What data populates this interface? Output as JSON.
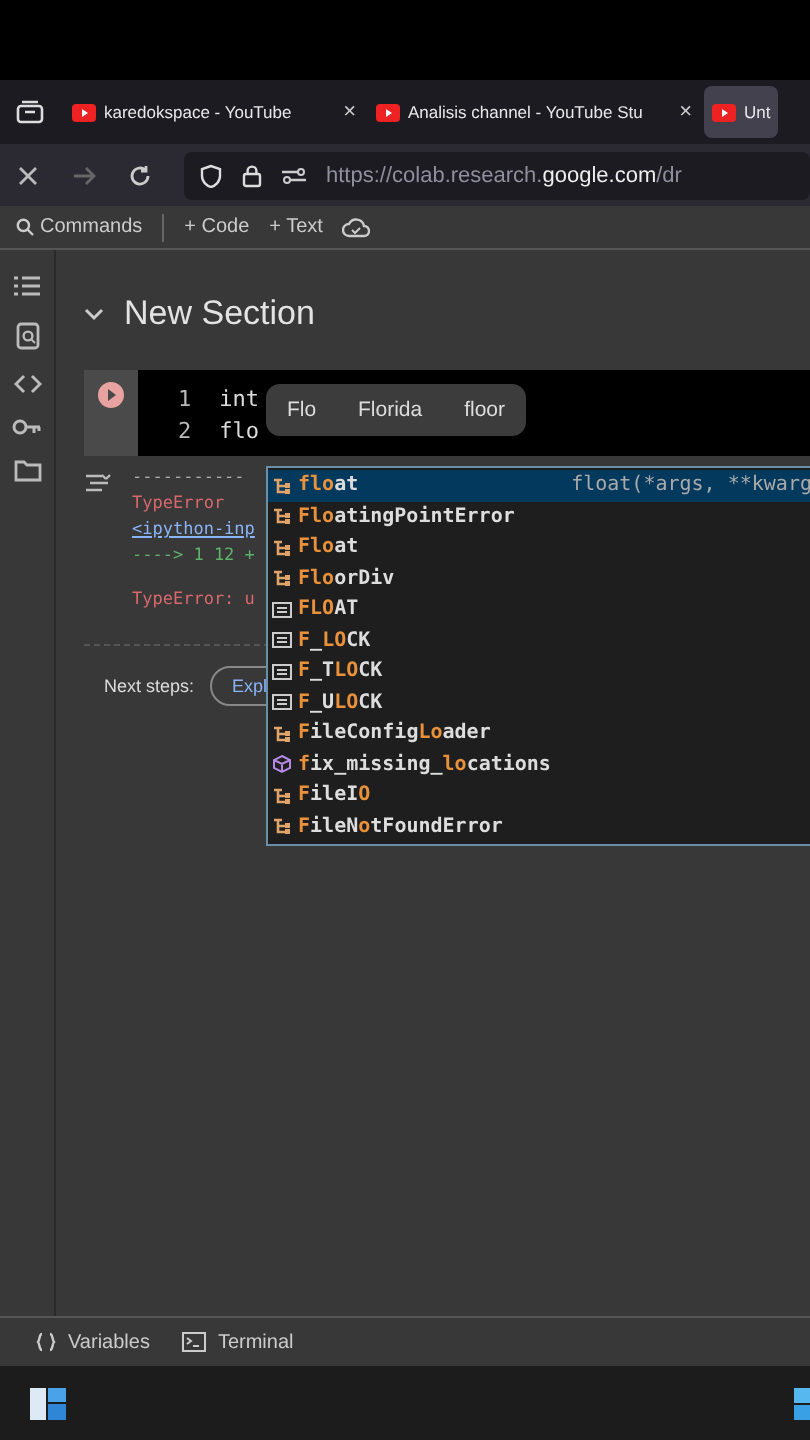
{
  "browser_tabs": [
    {
      "title": "karedokspace - YouTube",
      "close": "×",
      "selected": false
    },
    {
      "title": "Analisis channel - YouTube Stu",
      "close": "×",
      "selected": false
    },
    {
      "title": "Unt",
      "selected": true
    }
  ],
  "address": {
    "prefix": "https://colab.research.",
    "domain": "google.com",
    "rest": "/dr"
  },
  "toolbar": [
    {
      "label": "Commands",
      "kind": "search"
    },
    {
      "label": "+ Code",
      "kind": "plain"
    },
    {
      "label": "+ Text",
      "kind": "plain"
    }
  ],
  "section": {
    "title": "New Section",
    "expanded": true
  },
  "code_lines": [
    {
      "number": "1",
      "text": "int"
    },
    {
      "number": "2",
      "text": "flo"
    }
  ],
  "output": [
    {
      "text": "-----------",
      "kind": "rule"
    },
    {
      "text": "TypeError",
      "kind": "error"
    },
    {
      "text": "<ipython-inp",
      "kind": "link"
    },
    {
      "text": "----> 1 12 +",
      "kind": "arrow"
    },
    {
      "text": "TypeError: u",
      "kind": "error"
    }
  ],
  "next_steps": {
    "label": "Next steps:",
    "button": "Expl"
  },
  "suggestions": [
    "Flo",
    "Florida",
    "floor"
  ],
  "completions": [
    {
      "kind": "class",
      "selected": true,
      "parts": [
        {
          "t": "flo",
          "m": true
        },
        {
          "t": "at",
          "m": false
        }
      ],
      "detail": "float(*args, **kwarg"
    },
    {
      "kind": "class",
      "selected": false,
      "parts": [
        {
          "t": "Flo",
          "m": true
        },
        {
          "t": "atingPointError",
          "m": false
        }
      ]
    },
    {
      "kind": "class",
      "selected": false,
      "parts": [
        {
          "t": "Flo",
          "m": true
        },
        {
          "t": "at",
          "m": false
        }
      ]
    },
    {
      "kind": "class",
      "selected": false,
      "parts": [
        {
          "t": "Flo",
          "m": true
        },
        {
          "t": "orDiv",
          "m": false
        }
      ]
    },
    {
      "kind": "constant",
      "selected": false,
      "parts": [
        {
          "t": "FLO",
          "m": true
        },
        {
          "t": "AT",
          "m": false
        }
      ]
    },
    {
      "kind": "constant",
      "selected": false,
      "parts": [
        {
          "t": "F",
          "m": true
        },
        {
          "t": "_",
          "m": false
        },
        {
          "t": "LO",
          "m": true
        },
        {
          "t": "CK",
          "m": false
        }
      ]
    },
    {
      "kind": "constant",
      "selected": false,
      "parts": [
        {
          "t": "F",
          "m": true
        },
        {
          "t": "_T",
          "m": false
        },
        {
          "t": "LO",
          "m": true
        },
        {
          "t": "CK",
          "m": false
        }
      ]
    },
    {
      "kind": "constant",
      "selected": false,
      "parts": [
        {
          "t": "F",
          "m": true
        },
        {
          "t": "_U",
          "m": false
        },
        {
          "t": "LO",
          "m": true
        },
        {
          "t": "CK",
          "m": false
        }
      ]
    },
    {
      "kind": "class",
      "selected": false,
      "parts": [
        {
          "t": "F",
          "m": true
        },
        {
          "t": "ileConfig",
          "m": false
        },
        {
          "t": "Lo",
          "m": true
        },
        {
          "t": "ader",
          "m": false
        }
      ]
    },
    {
      "kind": "function",
      "selected": false,
      "parts": [
        {
          "t": "f",
          "m": true
        },
        {
          "t": "ix_missing_",
          "m": false
        },
        {
          "t": "lo",
          "m": true
        },
        {
          "t": "cations",
          "m": false
        }
      ]
    },
    {
      "kind": "class",
      "selected": false,
      "parts": [
        {
          "t": "F",
          "m": true
        },
        {
          "t": "ileI",
          "m": false
        },
        {
          "t": "O",
          "m": true
        }
      ]
    },
    {
      "kind": "class",
      "selected": false,
      "parts": [
        {
          "t": "F",
          "m": true
        },
        {
          "t": "ileN",
          "m": false
        },
        {
          "t": "o",
          "m": true
        },
        {
          "t": "tFoundError",
          "m": false
        }
      ]
    }
  ],
  "bottom_bar": [
    {
      "label": "Variables",
      "kind": "braces"
    },
    {
      "label": "Terminal",
      "kind": "terminal"
    }
  ]
}
